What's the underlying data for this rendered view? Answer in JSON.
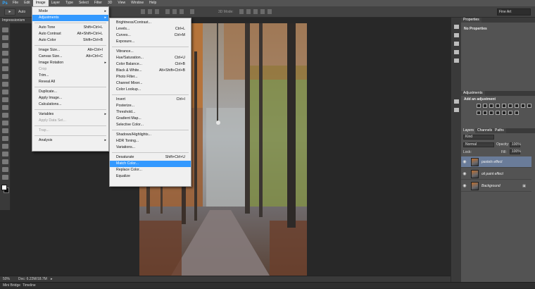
{
  "app": {
    "logo": "Ps"
  },
  "menubar": {
    "items": [
      "File",
      "Edit",
      "Image",
      "Layer",
      "Type",
      "Select",
      "Filter",
      "3D",
      "View",
      "Window",
      "Help"
    ],
    "active_index": 2
  },
  "options": {
    "auto_label": "Auto",
    "mode_3d": "3D Mode:",
    "workspace": "Fine Art"
  },
  "document": {
    "tab_title": "Impressionism"
  },
  "status": {
    "zoom": "50%",
    "doc_info": "Doc: 6.22M/18.7M"
  },
  "bottom_tabs": [
    "Mini Bridge",
    "Timeline"
  ],
  "image_menu": {
    "items": [
      {
        "label": "Mode",
        "shortcut": "",
        "submenu": true,
        "disabled": false,
        "highlight": false
      },
      {
        "label": "Adjustments",
        "shortcut": "",
        "submenu": true,
        "disabled": false,
        "highlight": true,
        "sep_after": true
      },
      {
        "label": "Auto Tone",
        "shortcut": "Shift+Ctrl+L",
        "submenu": false,
        "disabled": false,
        "highlight": false
      },
      {
        "label": "Auto Contrast",
        "shortcut": "Alt+Shift+Ctrl+L",
        "submenu": false,
        "disabled": false,
        "highlight": false
      },
      {
        "label": "Auto Color",
        "shortcut": "Shift+Ctrl+B",
        "submenu": false,
        "disabled": false,
        "highlight": false,
        "sep_after": true
      },
      {
        "label": "Image Size...",
        "shortcut": "Alt+Ctrl+I",
        "submenu": false,
        "disabled": false,
        "highlight": false
      },
      {
        "label": "Canvas Size...",
        "shortcut": "Alt+Ctrl+C",
        "submenu": false,
        "disabled": false,
        "highlight": false
      },
      {
        "label": "Image Rotation",
        "shortcut": "",
        "submenu": true,
        "disabled": false,
        "highlight": false
      },
      {
        "label": "Crop",
        "shortcut": "",
        "submenu": false,
        "disabled": true,
        "highlight": false
      },
      {
        "label": "Trim...",
        "shortcut": "",
        "submenu": false,
        "disabled": false,
        "highlight": false
      },
      {
        "label": "Reveal All",
        "shortcut": "",
        "submenu": false,
        "disabled": false,
        "highlight": false,
        "sep_after": true
      },
      {
        "label": "Duplicate...",
        "shortcut": "",
        "submenu": false,
        "disabled": false,
        "highlight": false
      },
      {
        "label": "Apply Image...",
        "shortcut": "",
        "submenu": false,
        "disabled": false,
        "highlight": false
      },
      {
        "label": "Calculations...",
        "shortcut": "",
        "submenu": false,
        "disabled": false,
        "highlight": false,
        "sep_after": true
      },
      {
        "label": "Variables",
        "shortcut": "",
        "submenu": true,
        "disabled": false,
        "highlight": false
      },
      {
        "label": "Apply Data Set...",
        "shortcut": "",
        "submenu": false,
        "disabled": true,
        "highlight": false,
        "sep_after": true
      },
      {
        "label": "Trap...",
        "shortcut": "",
        "submenu": false,
        "disabled": true,
        "highlight": false,
        "sep_after": true
      },
      {
        "label": "Analysis",
        "shortcut": "",
        "submenu": true,
        "disabled": false,
        "highlight": false
      }
    ]
  },
  "adjust_menu": {
    "items": [
      {
        "label": "Brightness/Contrast...",
        "shortcut": "",
        "highlight": false
      },
      {
        "label": "Levels...",
        "shortcut": "Ctrl+L",
        "highlight": false
      },
      {
        "label": "Curves...",
        "shortcut": "Ctrl+M",
        "highlight": false
      },
      {
        "label": "Exposure...",
        "shortcut": "",
        "highlight": false,
        "sep_after": true
      },
      {
        "label": "Vibrance...",
        "shortcut": "",
        "highlight": false
      },
      {
        "label": "Hue/Saturation...",
        "shortcut": "Ctrl+U",
        "highlight": false
      },
      {
        "label": "Color Balance...",
        "shortcut": "Ctrl+B",
        "highlight": false
      },
      {
        "label": "Black & White...",
        "shortcut": "Alt+Shift+Ctrl+B",
        "highlight": false
      },
      {
        "label": "Photo Filter...",
        "shortcut": "",
        "highlight": false
      },
      {
        "label": "Channel Mixer...",
        "shortcut": "",
        "highlight": false
      },
      {
        "label": "Color Lookup...",
        "shortcut": "",
        "highlight": false,
        "sep_after": true
      },
      {
        "label": "Invert",
        "shortcut": "Ctrl+I",
        "highlight": false
      },
      {
        "label": "Posterize...",
        "shortcut": "",
        "highlight": false
      },
      {
        "label": "Threshold...",
        "shortcut": "",
        "highlight": false
      },
      {
        "label": "Gradient Map...",
        "shortcut": "",
        "highlight": false
      },
      {
        "label": "Selective Color...",
        "shortcut": "",
        "highlight": false,
        "sep_after": true
      },
      {
        "label": "Shadows/Highlights...",
        "shortcut": "",
        "highlight": false
      },
      {
        "label": "HDR Toning...",
        "shortcut": "",
        "highlight": false
      },
      {
        "label": "Variations...",
        "shortcut": "",
        "highlight": false,
        "sep_after": true
      },
      {
        "label": "Desaturate",
        "shortcut": "Shift+Ctrl+U",
        "highlight": false
      },
      {
        "label": "Match Color...",
        "shortcut": "",
        "highlight": true
      },
      {
        "label": "Replace Color...",
        "shortcut": "",
        "highlight": false
      },
      {
        "label": "Equalize",
        "shortcut": "",
        "highlight": false
      }
    ]
  },
  "properties": {
    "tab": "Properties",
    "message": "No Properties"
  },
  "adjustments": {
    "tab": "Adjustments",
    "title": "Add an adjustment"
  },
  "layers": {
    "tabs": [
      "Layers",
      "Channels",
      "Paths"
    ],
    "kind": "Kind",
    "blend_mode": "Normal",
    "opacity_label": "Opacity:",
    "opacity": "100%",
    "lock_label": "Lock:",
    "fill_label": "Fill:",
    "fill": "100%",
    "items": [
      {
        "name": "pastels effect",
        "selected": true,
        "locked": false
      },
      {
        "name": "oil paint effect",
        "selected": false,
        "locked": false
      },
      {
        "name": "Background",
        "selected": false,
        "locked": true
      }
    ]
  },
  "colors": {
    "menu_highlight": "#3399ff",
    "layer_selected": "#6a7c99",
    "panel_bg": "#535353"
  }
}
